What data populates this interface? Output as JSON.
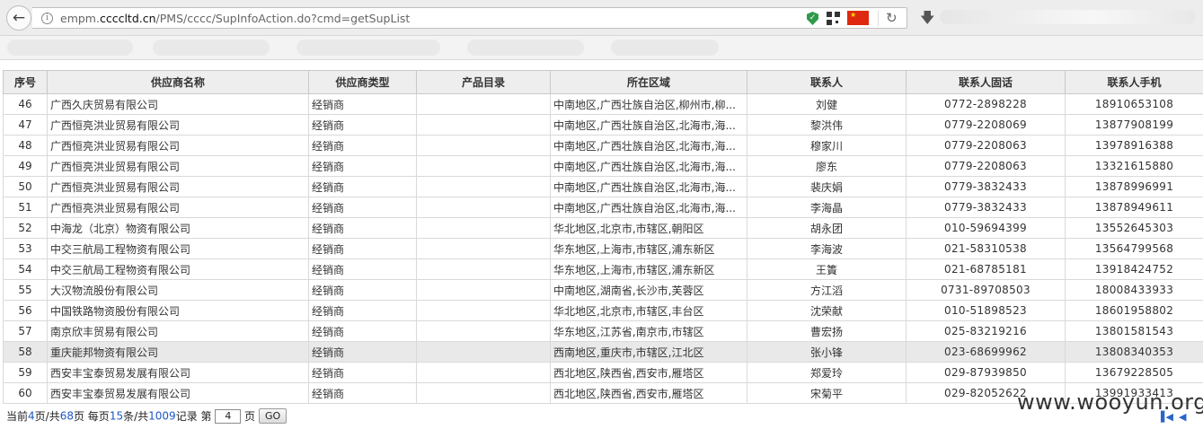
{
  "browser": {
    "url_prefix": "empm.",
    "url_domain": "ccccltd.cn",
    "url_path": "/PMS/cccc/SupInfoAction.do?cmd=getSupList"
  },
  "table": {
    "headers": [
      "序号",
      "供应商名称",
      "供应商类型",
      "产品目录",
      "所在区域",
      "联系人",
      "联系人固话",
      "联系人手机"
    ],
    "rows": [
      {
        "no": "46",
        "name": "广西久庆贸易有限公司",
        "type": "经销商",
        "catalog": "",
        "region": "中南地区,广西壮族自治区,柳州市,柳...",
        "contact": "刘健",
        "phone": "0772-2898228",
        "mobile": "18910653108"
      },
      {
        "no": "47",
        "name": "广西恒亮洪业贸易有限公司",
        "type": "经销商",
        "catalog": "",
        "region": "中南地区,广西壮族自治区,北海市,海...",
        "contact": "黎洪伟",
        "phone": "0779-2208069",
        "mobile": "13877908199"
      },
      {
        "no": "48",
        "name": "广西恒亮洪业贸易有限公司",
        "type": "经销商",
        "catalog": "",
        "region": "中南地区,广西壮族自治区,北海市,海...",
        "contact": "穆家川",
        "phone": "0779-2208063",
        "mobile": "13978916388"
      },
      {
        "no": "49",
        "name": "广西恒亮洪业贸易有限公司",
        "type": "经销商",
        "catalog": "",
        "region": "中南地区,广西壮族自治区,北海市,海...",
        "contact": "廖东",
        "phone": "0779-2208063",
        "mobile": "13321615880"
      },
      {
        "no": "50",
        "name": "广西恒亮洪业贸易有限公司",
        "type": "经销商",
        "catalog": "",
        "region": "中南地区,广西壮族自治区,北海市,海...",
        "contact": "裴庆娟",
        "phone": "0779-3832433",
        "mobile": "13878996991"
      },
      {
        "no": "51",
        "name": "广西恒亮洪业贸易有限公司",
        "type": "经销商",
        "catalog": "",
        "region": "中南地区,广西壮族自治区,北海市,海...",
        "contact": "李海晶",
        "phone": "0779-3832433",
        "mobile": "13878949611"
      },
      {
        "no": "52",
        "name": "中海龙（北京）物资有限公司",
        "type": "经销商",
        "catalog": "",
        "region": "华北地区,北京市,市辖区,朝阳区",
        "contact": "胡永团",
        "phone": "010-59694399",
        "mobile": "13552645303"
      },
      {
        "no": "53",
        "name": "中交三航局工程物资有限公司",
        "type": "经销商",
        "catalog": "",
        "region": "华东地区,上海市,市辖区,浦东新区",
        "contact": "李海波",
        "phone": "021-58310538",
        "mobile": "13564799568"
      },
      {
        "no": "54",
        "name": "中交三航局工程物资有限公司",
        "type": "经销商",
        "catalog": "",
        "region": "华东地区,上海市,市辖区,浦东新区",
        "contact": "王簀",
        "phone": "021-68785181",
        "mobile": "13918424752"
      },
      {
        "no": "55",
        "name": "大汉物流股份有限公司",
        "type": "经销商",
        "catalog": "",
        "region": "中南地区,湖南省,长沙市,芙蓉区",
        "contact": "方江滔",
        "phone": "0731-89708503",
        "mobile": "18008433933"
      },
      {
        "no": "56",
        "name": "中国铁路物资股份有限公司",
        "type": "经销商",
        "catalog": "",
        "region": "华北地区,北京市,市辖区,丰台区",
        "contact": "沈荣献",
        "phone": "010-51898523",
        "mobile": "18601958802"
      },
      {
        "no": "57",
        "name": "南京欣丰贸易有限公司",
        "type": "经销商",
        "catalog": "",
        "region": "华东地区,江苏省,南京市,市辖区",
        "contact": "曹宏扬",
        "phone": "025-83219216",
        "mobile": "13801581543"
      },
      {
        "no": "58",
        "name": "重庆能邦物资有限公司",
        "type": "经销商",
        "catalog": "",
        "region": "西南地区,重庆市,市辖区,江北区",
        "contact": "张小锋",
        "phone": "023-68699962",
        "mobile": "13808340353"
      },
      {
        "no": "59",
        "name": "西安丰宝泰贸易发展有限公司",
        "type": "经销商",
        "catalog": "",
        "region": "西北地区,陕西省,西安市,雁塔区",
        "contact": "郑爱玲",
        "phone": "029-87939850",
        "mobile": "13679228505"
      },
      {
        "no": "60",
        "name": "西安丰宝泰贸易发展有限公司",
        "type": "经销商",
        "catalog": "",
        "region": "西北地区,陕西省,西安市,雁塔区",
        "contact": "宋菊平",
        "phone": "029-82052622",
        "mobile": "13991933413"
      }
    ]
  },
  "pager": {
    "label_current": "当前",
    "current_page": "4",
    "label_of": "页/共",
    "total_pages": "68",
    "label_per_page": "页 每页",
    "per_page": "15",
    "label_items_total": "条/共",
    "total_records": "1009",
    "label_records_goto": "记录 第",
    "page_input_value": "4",
    "label_page": "页",
    "go_label": "GO"
  },
  "watermark": "www.wooyun.org",
  "colors": {
    "accent_blue": "#1f57c3",
    "header_bg": "#eeeeee",
    "highlight_row": "#e9e9e9"
  }
}
